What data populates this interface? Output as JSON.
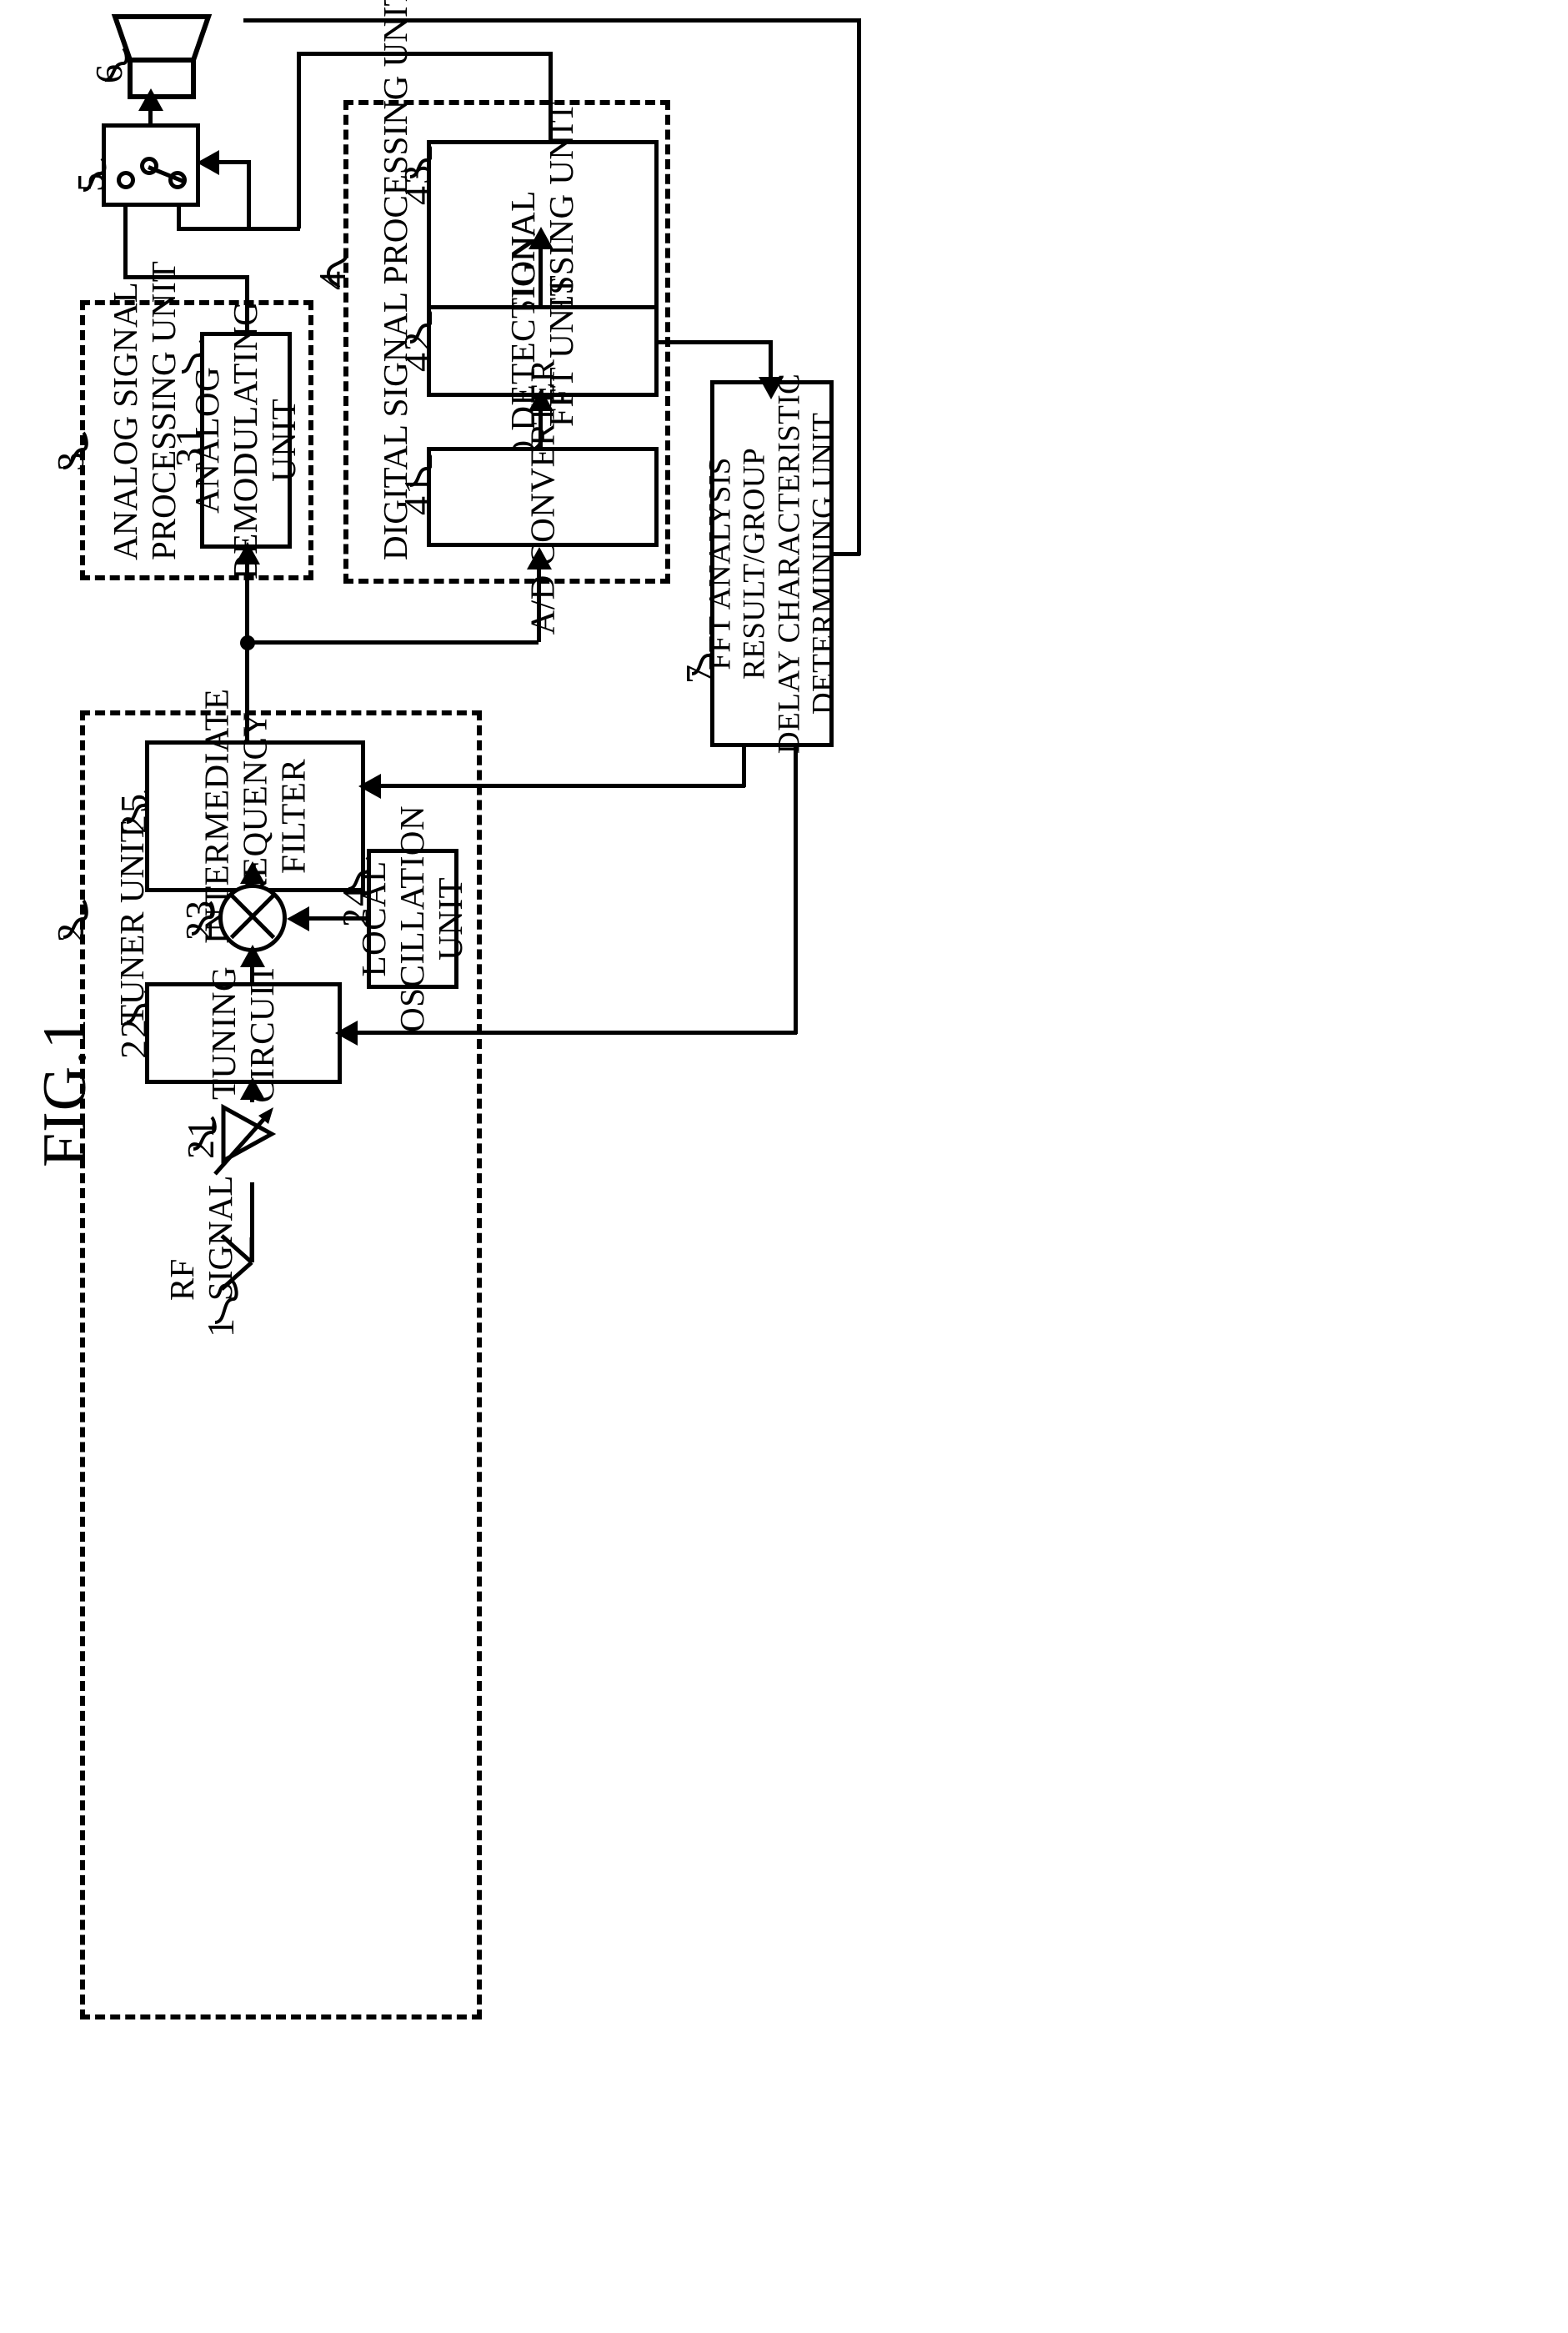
{
  "figure": {
    "title": "FIG.1",
    "type": "patent-block-diagram",
    "orientation": "rotated-90-ccw"
  },
  "blocks": [
    {
      "ref": "43",
      "name": "signal-processing-unit",
      "label": "SIGNAL\nPROCESSING UNIT"
    },
    {
      "ref": "42",
      "name": "iq-detection-fft-unit",
      "label": "IQ DETECTION/\nFFT UNIT"
    },
    {
      "ref": "41",
      "name": "ad-converter",
      "label": "A/D CONVERTER"
    },
    {
      "ref": "31",
      "name": "analog-demodulating-unit",
      "label": "ANALOG\nDEMODULATING\nUNIT"
    },
    {
      "ref": "7",
      "name": "fft-analysis-unit",
      "label": "FFT ANALYSIS\nRESULT/GROUP\nDELAY CHARACTERISTIC\nDETERMINING UNIT"
    },
    {
      "ref": "25",
      "name": "intermediate-frequency-filter",
      "label": "INTERMEDIATE\nFREQUENCY\nFILTER"
    },
    {
      "ref": "24",
      "name": "local-oscillation-unit",
      "label": "LOCAL\nOSCILLATION\nUNIT"
    },
    {
      "ref": "22",
      "name": "tuning-circuit",
      "label": "TUNING\nCIRCUIT"
    }
  ],
  "groups": [
    {
      "ref": "4",
      "name": "digital-signal-processing-unit",
      "label": "DIGITAL SIGNAL PROCESSING UNIT"
    },
    {
      "ref": "3",
      "name": "analog-signal-processing-unit",
      "label": "ANALOG SIGNAL\nPROCESSING UNIT"
    },
    {
      "ref": "2",
      "name": "tuner-unit",
      "label": "TUNER UNIT"
    }
  ],
  "symbols": [
    {
      "ref": "6",
      "name": "speaker",
      "label": ""
    },
    {
      "ref": "5",
      "name": "changeover-switch",
      "label": ""
    },
    {
      "ref": "23",
      "name": "mixer",
      "label": ""
    },
    {
      "ref": "21",
      "name": "rf-amplifier",
      "label": ""
    },
    {
      "ref": "1",
      "name": "antenna",
      "label": "RF\nSIGNAL"
    }
  ],
  "refs": {
    "r1": "1",
    "r2": "2",
    "r3": "3",
    "r4": "4",
    "r5": "5",
    "r6": "6",
    "r7": "7",
    "r21": "21",
    "r22": "22",
    "r23": "23",
    "r24": "24",
    "r25": "25",
    "r31": "31",
    "r41": "41",
    "r42": "42",
    "r43": "43"
  },
  "labels": {
    "fig": "FIG.1",
    "signal_processing_unit": "SIGNAL\nPROCESSING UNIT",
    "iq_detection_fft_unit": "IQ DETECTION/\nFFT UNIT",
    "ad_converter": "A/D CONVERTER",
    "analog_demodulating_unit": "ANALOG\nDEMODULATING\nUNIT",
    "fft_analysis_unit": "FFT ANALYSIS\nRESULT/GROUP\nDELAY CHARACTERISTIC\nDETERMINING UNIT",
    "intermediate_frequency_filter": "INTERMEDIATE\nFREQUENCY\nFILTER",
    "local_oscillation_unit": "LOCAL\nOSCILLATION\nUNIT",
    "tuning_circuit": "TUNING\nCIRCUIT",
    "digital_signal_processing_unit": "DIGITAL SIGNAL PROCESSING UNIT",
    "analog_signal_processing_unit": "ANALOG SIGNAL\nPROCESSING UNIT",
    "tuner_unit": "TUNER UNIT",
    "rf_signal": "RF\nSIGNAL"
  }
}
